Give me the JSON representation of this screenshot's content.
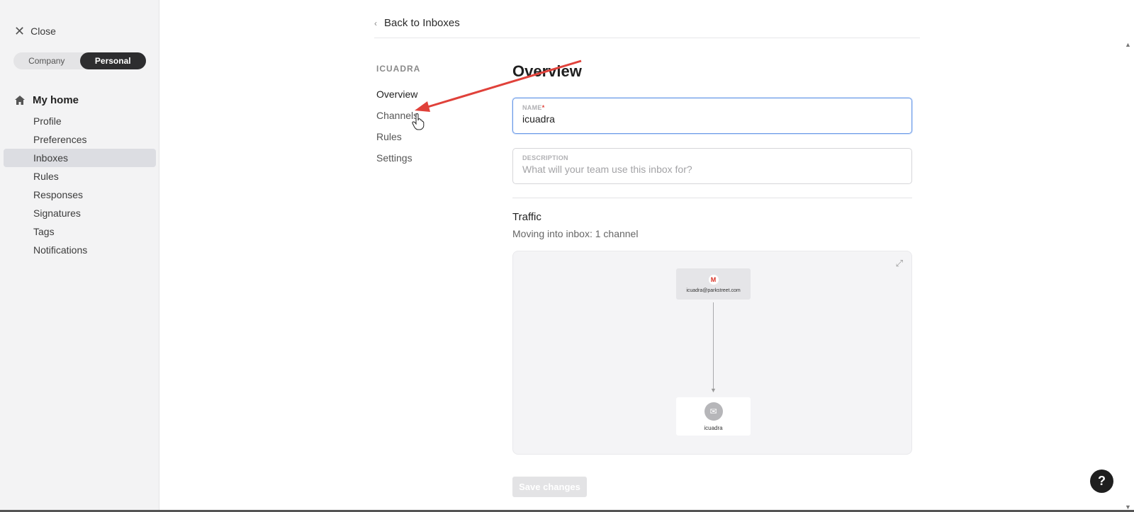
{
  "sidebar": {
    "close_label": "Close",
    "segment": {
      "options": [
        "Company",
        "Personal"
      ],
      "active": "Personal"
    },
    "home_label": "My home",
    "items": [
      {
        "label": "Profile"
      },
      {
        "label": "Preferences"
      },
      {
        "label": "Inboxes",
        "selected": true
      },
      {
        "label": "Rules"
      },
      {
        "label": "Responses"
      },
      {
        "label": "Signatures"
      },
      {
        "label": "Tags"
      },
      {
        "label": "Notifications"
      }
    ]
  },
  "header": {
    "back_label": "Back to Inboxes"
  },
  "subnav": {
    "group": "ICUADRA",
    "items": [
      {
        "label": "Overview",
        "active": true
      },
      {
        "label": "Channels"
      },
      {
        "label": "Rules"
      },
      {
        "label": "Settings"
      }
    ]
  },
  "main": {
    "title": "Overview",
    "name_field": {
      "label": "NAME",
      "required_mark": "*",
      "value": "icuadra"
    },
    "description_field": {
      "label": "DESCRIPTION",
      "placeholder": "What will your team use this inbox for?"
    },
    "traffic_title": "Traffic",
    "traffic_subtitle": "Moving into inbox: 1 channel",
    "diagram": {
      "source_email": "icuadra@parkstreet.com",
      "source_icon": "gmail-icon",
      "destination_label": "icuadra",
      "destination_icon": "inbox-icon"
    },
    "save_label": "Save changes"
  },
  "help_label": "?",
  "colors": {
    "accent_focus": "#6d9be6",
    "annotation_arrow": "#e0413a",
    "dark_toggle": "#2d2d2f"
  }
}
